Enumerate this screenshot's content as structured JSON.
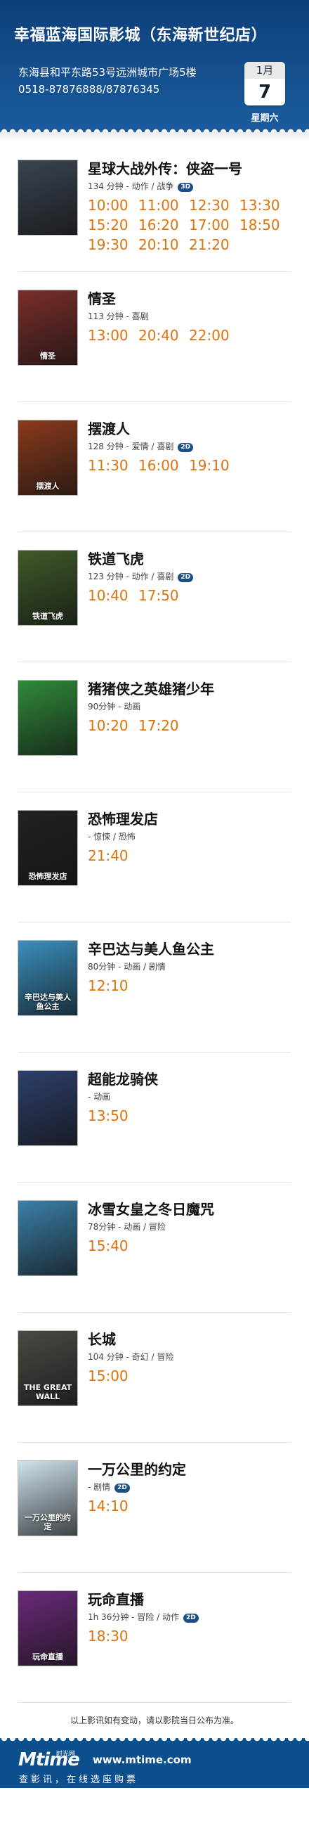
{
  "cinema": {
    "name": "幸福蓝海国际影城（东海新世纪店）",
    "address": "东海县和平东路53号远洲城市广场5楼",
    "phone": "0518-87876888/87876345"
  },
  "date": {
    "month": "1月",
    "day": "7",
    "weekday": "星期六"
  },
  "movies": [
    {
      "title": "星球大战外传：侠盗一号",
      "meta": "134 分钟 - 动作 / 战争",
      "badge": "3D",
      "poster_color": "#3a4450",
      "times": [
        "10:00",
        "11:00",
        "12:30",
        "13:30",
        "15:20",
        "16:20",
        "17:00",
        "18:50",
        "19:30",
        "20:10",
        "21:20"
      ]
    },
    {
      "title": "情圣",
      "meta": "113 分钟 - 喜剧",
      "badge": "",
      "poster_color": "#7a2e2a",
      "poster_text": "情圣",
      "times": [
        "13:00",
        "20:40",
        "22:00"
      ]
    },
    {
      "title": "摆渡人",
      "meta": "128 分钟 - 爱情 / 喜剧",
      "badge": "2D",
      "poster_color": "#8a3a1c",
      "poster_text": "摆渡人",
      "times": [
        "11:30",
        "16:00",
        "19:10"
      ]
    },
    {
      "title": "铁道飞虎",
      "meta": "123 分钟 - 动作 / 喜剧",
      "badge": "2D",
      "poster_color": "#3f5a2a",
      "poster_text": "铁道飞虎",
      "times": [
        "10:40",
        "17:50"
      ]
    },
    {
      "title": "猪猪侠之英雄猪少年",
      "meta": "90分钟 - 动画",
      "badge": "",
      "poster_color": "#2f8a3a",
      "poster_text": "",
      "times": [
        "10:20",
        "17:20"
      ]
    },
    {
      "title": "恐怖理发店",
      "meta": " - 惊悚 / 恐怖",
      "badge": "",
      "poster_color": "#222222",
      "poster_text": "恐怖理发店",
      "times": [
        "21:40"
      ]
    },
    {
      "title": "辛巴达与美人鱼公主",
      "meta": "80分钟 - 动画 / 剧情",
      "badge": "",
      "poster_color": "#3a8fbf",
      "poster_text": "辛巴达与美人鱼公主",
      "times": [
        "12:10"
      ]
    },
    {
      "title": "超能龙骑侠",
      "meta": " - 动画",
      "badge": "",
      "poster_color": "#2d3f6a",
      "poster_text": "",
      "times": [
        "13:50"
      ]
    },
    {
      "title": "冰雪女皇之冬日魔咒",
      "meta": "78分钟 - 动画 / 冒险",
      "badge": "",
      "poster_color": "#3a7fa8",
      "poster_text": "",
      "times": [
        "15:40"
      ]
    },
    {
      "title": "长城",
      "meta": "104 分钟 - 奇幻 / 冒险",
      "badge": "",
      "poster_color": "#4a4a44",
      "poster_text": "THE GREAT WALL",
      "times": [
        "15:00"
      ]
    },
    {
      "title": "一万公里的约定",
      "meta": " - 剧情",
      "badge": "2D",
      "poster_color": "#cfe3ee",
      "poster_text": "一万公里的约定",
      "times": [
        "14:10"
      ]
    },
    {
      "title": "玩命直播",
      "meta": "1h 36分钟 - 冒险 / 动作",
      "badge": "2D",
      "poster_color": "#6a2a7a",
      "poster_text": "玩命直播",
      "times": [
        "18:30"
      ]
    }
  ],
  "notice": "以上影讯如有变动，请以影院当日公布为准。",
  "footer": {
    "logo_text": "Mtime",
    "logo_cn": "时光网",
    "url": "www.mtime.com",
    "slogan": "查影讯，在线选座购票"
  }
}
